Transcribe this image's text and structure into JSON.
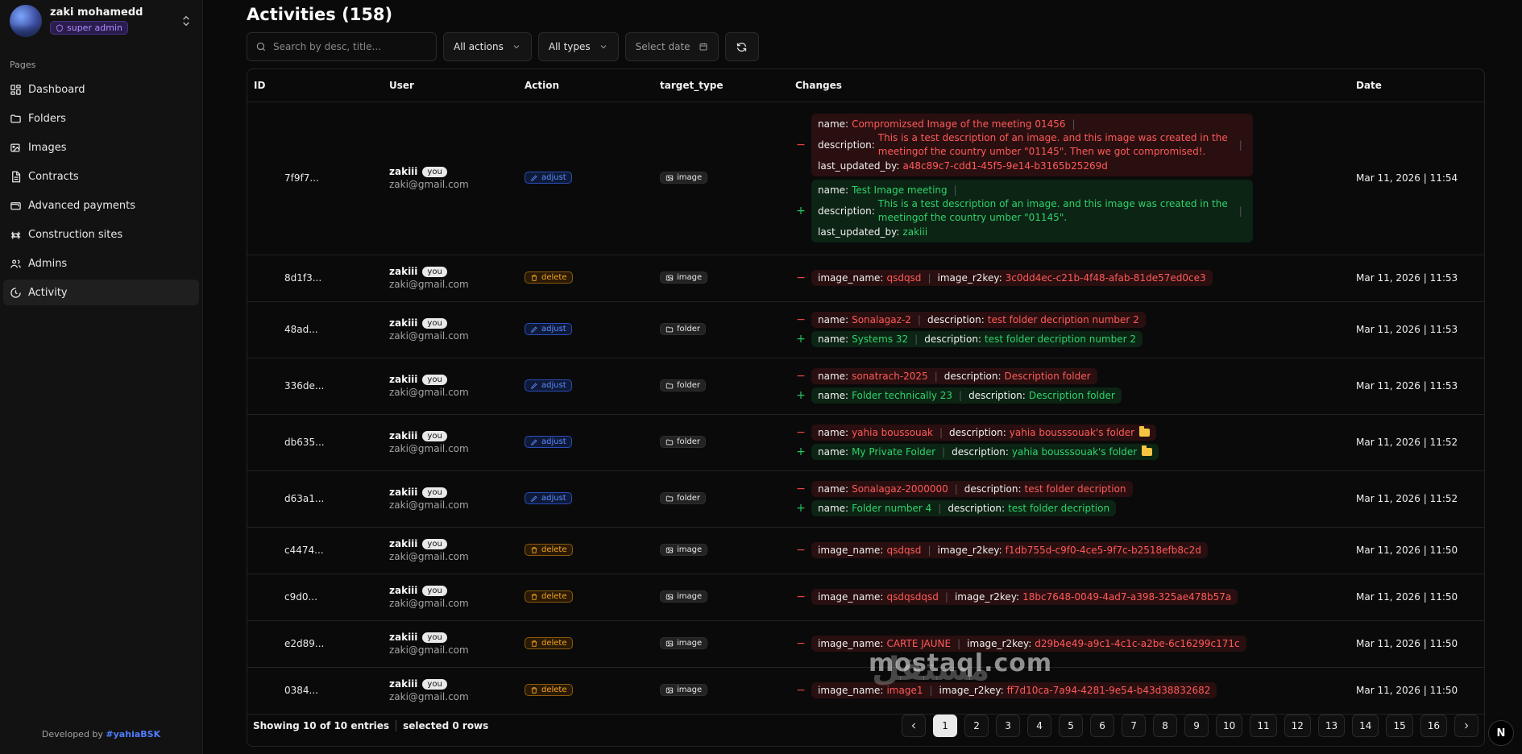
{
  "profile": {
    "name": "zaki mohamedd",
    "role": "super admin"
  },
  "sidebar": {
    "section_label": "Pages",
    "items": [
      {
        "label": "Dashboard",
        "icon": "dashboard-icon"
      },
      {
        "label": "Folders",
        "icon": "folder-icon"
      },
      {
        "label": "Images",
        "icon": "images-icon"
      },
      {
        "label": "Contracts",
        "icon": "contract-icon"
      },
      {
        "label": "Advanced payments",
        "icon": "wallet-icon"
      },
      {
        "label": "Construction sites",
        "icon": "construction-icon"
      },
      {
        "label": "Admins",
        "icon": "admins-icon"
      },
      {
        "label": "Activity",
        "icon": "activity-icon",
        "active": true
      }
    ],
    "credits_prefix": "Developed by ",
    "credits_author": "#yahiaBSK"
  },
  "page": {
    "title": "Activities (158)"
  },
  "toolbar": {
    "search_placeholder": "Search by desc, title...",
    "actions_filter": "All actions",
    "types_filter": "All types",
    "date_filter": "Select date"
  },
  "table": {
    "columns": [
      "ID",
      "User",
      "Action",
      "target_type",
      "Changes",
      "Date"
    ],
    "rows": [
      {
        "id": "7f9f7...",
        "user": "zakiii",
        "you": "you",
        "email": "zaki@gmail.com",
        "action": "adjust",
        "target": "image",
        "date": "Mar 11, 2026 | 11:54",
        "old": {
          "name": "Compromizsed Image of the meeting 01456",
          "description": "This is a test description of an image. and this image was created in the meetingof the country umber \"01145\". Then we got compromised!.",
          "last_updated_by": "a48c89c7-cdd1-45f5-9e14-b3165b25269d"
        },
        "new": {
          "name": "Test Image meeting",
          "description": "This is a test description of an image. and this image was created in the meetingof the country umber \"01145\".",
          "last_updated_by": "zakiii"
        }
      },
      {
        "id": "8d1f3...",
        "user": "zakiii",
        "you": "you",
        "email": "zaki@gmail.com",
        "action": "delete",
        "target": "image",
        "date": "Mar 11, 2026 | 11:53",
        "old": {
          "image_name": "qsdqsd",
          "image_r2key": "3c0dd4ec-c21b-4f48-afab-81de57ed0ce3"
        }
      },
      {
        "id": "48ad...",
        "user": "zakiii",
        "you": "you",
        "email": "zaki@gmail.com",
        "action": "adjust",
        "target": "folder",
        "date": "Mar 11, 2026 | 11:53",
        "old": {
          "name": "Sonalagaz-2",
          "description": "test folder decription number 2"
        },
        "new": {
          "name": "Systems 32",
          "description": "test folder decription number 2"
        }
      },
      {
        "id": "336de...",
        "user": "zakiii",
        "you": "you",
        "email": "zaki@gmail.com",
        "action": "adjust",
        "target": "folder",
        "date": "Mar 11, 2026 | 11:53",
        "old": {
          "name": "sonatrach-2025",
          "description": "Description folder"
        },
        "new": {
          "name": "Folder technically 23",
          "description": "Description folder"
        }
      },
      {
        "id": "db635...",
        "user": "zakiii",
        "you": "you",
        "email": "zaki@gmail.com",
        "action": "adjust",
        "target": "folder",
        "date": "Mar 11, 2026 | 11:52",
        "old": {
          "name": "yahia boussouak",
          "description": "yahia bousssouak's folder"
        },
        "new": {
          "name": "My Private Folder",
          "description": "yahia bousssouak's folder"
        }
      },
      {
        "id": "d63a1...",
        "user": "zakiii",
        "you": "you",
        "email": "zaki@gmail.com",
        "action": "adjust",
        "target": "folder",
        "date": "Mar 11, 2026 | 11:52",
        "old": {
          "name": "Sonalagaz-2000000",
          "description": "test folder decription"
        },
        "new": {
          "name": "Folder number 4",
          "description": "test folder decription"
        }
      },
      {
        "id": "c4474...",
        "user": "zakiii",
        "you": "you",
        "email": "zaki@gmail.com",
        "action": "delete",
        "target": "image",
        "date": "Mar 11, 2026 | 11:50",
        "old": {
          "image_name": "qsdqsd",
          "image_r2key": "f1db755d-c9f0-4ce5-9f7c-b2518efb8c2d"
        }
      },
      {
        "id": "c9d0...",
        "user": "zakiii",
        "you": "you",
        "email": "zaki@gmail.com",
        "action": "delete",
        "target": "image",
        "date": "Mar 11, 2026 | 11:50",
        "old": {
          "image_name": "qsdqsdqsd",
          "image_r2key": "18bc7648-0049-4ad7-a398-325ae478b57a"
        }
      },
      {
        "id": "e2d89...",
        "user": "zakiii",
        "you": "you",
        "email": "zaki@gmail.com",
        "action": "delete",
        "target": "image",
        "date": "Mar 11, 2026 | 11:50",
        "old": {
          "image_name": "CARTE JAUNE",
          "image_r2key": "d29b4e49-a9c1-4c1c-a2be-6c16299c171c"
        }
      },
      {
        "id": "0384...",
        "user": "zakiii",
        "you": "you",
        "email": "zaki@gmail.com",
        "action": "delete",
        "target": "image",
        "date": "Mar 11, 2026 | 11:50",
        "old": {
          "image_name": "image1",
          "image_r2key": "ff7d10ca-7a94-4281-9e54-b43d38832682"
        }
      }
    ]
  },
  "footer": {
    "showing": "Showing 10 of 10 entries",
    "selected": "selected 0 rows",
    "pages": [
      "1",
      "2",
      "3",
      "4",
      "5",
      "6",
      "7",
      "8",
      "9",
      "10",
      "11",
      "12",
      "13",
      "14",
      "15",
      "16"
    ],
    "current_page": "1"
  },
  "watermark": {
    "text": "mostaql.com",
    "arabic": "مستقل"
  },
  "next_logo": "N",
  "colors": {
    "removed": "#ff5a5a",
    "added": "#2fd36b",
    "adjust": "#5b8cff",
    "delete": "#f5a524",
    "role": "#b18cff",
    "credits": "#4f7dff"
  }
}
